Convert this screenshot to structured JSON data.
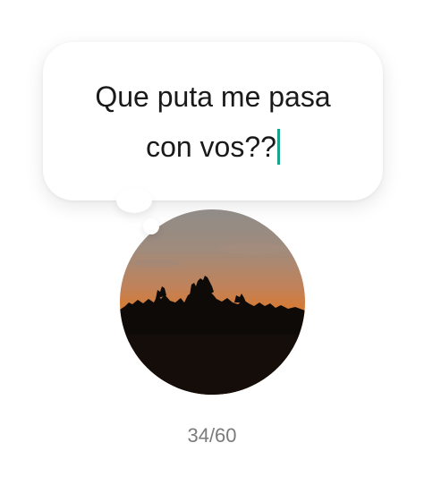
{
  "note": {
    "text": "Que puta me pasa con vos??",
    "char_count": "34/60"
  },
  "avatar": {
    "icon": "profile-photo-sunset-silhouette"
  },
  "colors": {
    "caret": "#1aa38c",
    "counter_text": "#7b7b7b",
    "bubble_bg": "#ffffff"
  }
}
